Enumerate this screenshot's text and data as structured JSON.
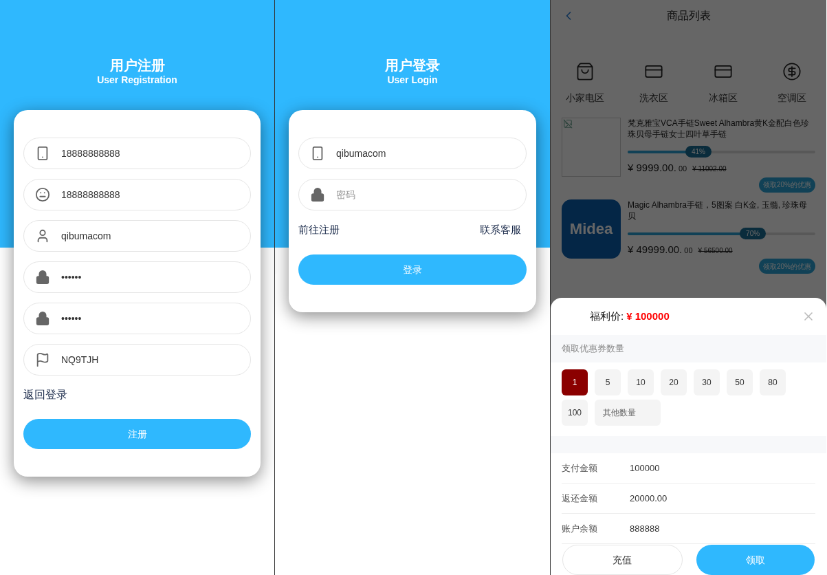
{
  "registration": {
    "title": "用户注册",
    "subtitle": "User Registration",
    "fields": [
      {
        "value": "18888888888"
      },
      {
        "value": "18888888888"
      },
      {
        "value": "qibumacom"
      },
      {
        "value": "••••••"
      },
      {
        "value": "••••••"
      },
      {
        "value": "NQ9TJH"
      }
    ],
    "link": "返回登录",
    "button": "注册"
  },
  "login": {
    "title": "用户登录",
    "subtitle": "User Login",
    "fields": [
      {
        "value": "qibumacom"
      },
      {
        "placeholder": "密码"
      }
    ],
    "links": [
      "前往注册",
      "联系客服"
    ],
    "button": "登录"
  },
  "product_list": {
    "title": "商品列表",
    "categories": [
      {
        "label": "小家电区"
      },
      {
        "label": "洗衣区"
      },
      {
        "label": "冰箱区"
      },
      {
        "label": "空调区"
      }
    ],
    "products": [
      {
        "kind": "broken",
        "name": "梵克雅宝VCA手链Sweet Alhambra黄K金配白色珍珠贝母手链女士四叶草手链",
        "level": 0.41,
        "progress_label": "41%",
        "price": "¥ 9999.00.",
        "price_tail": "00",
        "old_price": "¥ 11002.00",
        "coupon": "领取20%的优惠"
      },
      {
        "kind": "logo",
        "logo_text": "Midea",
        "name": "Magic Alhambra手链，5图案 白K金, 玉髓, 珍珠母贝",
        "level": 0.7,
        "progress_label": "70%",
        "price": "¥ 49999.00.",
        "price_tail": "00",
        "old_price": "¥ 56500.00",
        "coupon": "领取20%的优惠"
      }
    ]
  },
  "sheet": {
    "price_label": "福利价:",
    "price": "¥ 100000",
    "section_label": "领取优惠券数量",
    "options": [
      {
        "label": "1",
        "kind": "number",
        "selected": true
      },
      {
        "label": "5",
        "kind": "number",
        "selected": false
      },
      {
        "label": "10",
        "kind": "number",
        "selected": false
      },
      {
        "label": "20",
        "kind": "number",
        "selected": false
      },
      {
        "label": "30",
        "kind": "number",
        "selected": false
      },
      {
        "label": "50",
        "kind": "number",
        "selected": false
      },
      {
        "label": "80",
        "kind": "number",
        "selected": false
      },
      {
        "label": "100",
        "kind": "number",
        "selected": false
      },
      {
        "label": "其他数量",
        "kind": "other",
        "selected": false
      }
    ],
    "summary": [
      {
        "label": "支付金额",
        "value": "100000"
      },
      {
        "label": "返还金额",
        "value": "20000.00"
      },
      {
        "label": "账户余额",
        "value": "888888"
      }
    ],
    "buttons": [
      {
        "label": "充值",
        "kind": "outline"
      },
      {
        "label": "领取",
        "kind": "primary"
      }
    ]
  }
}
